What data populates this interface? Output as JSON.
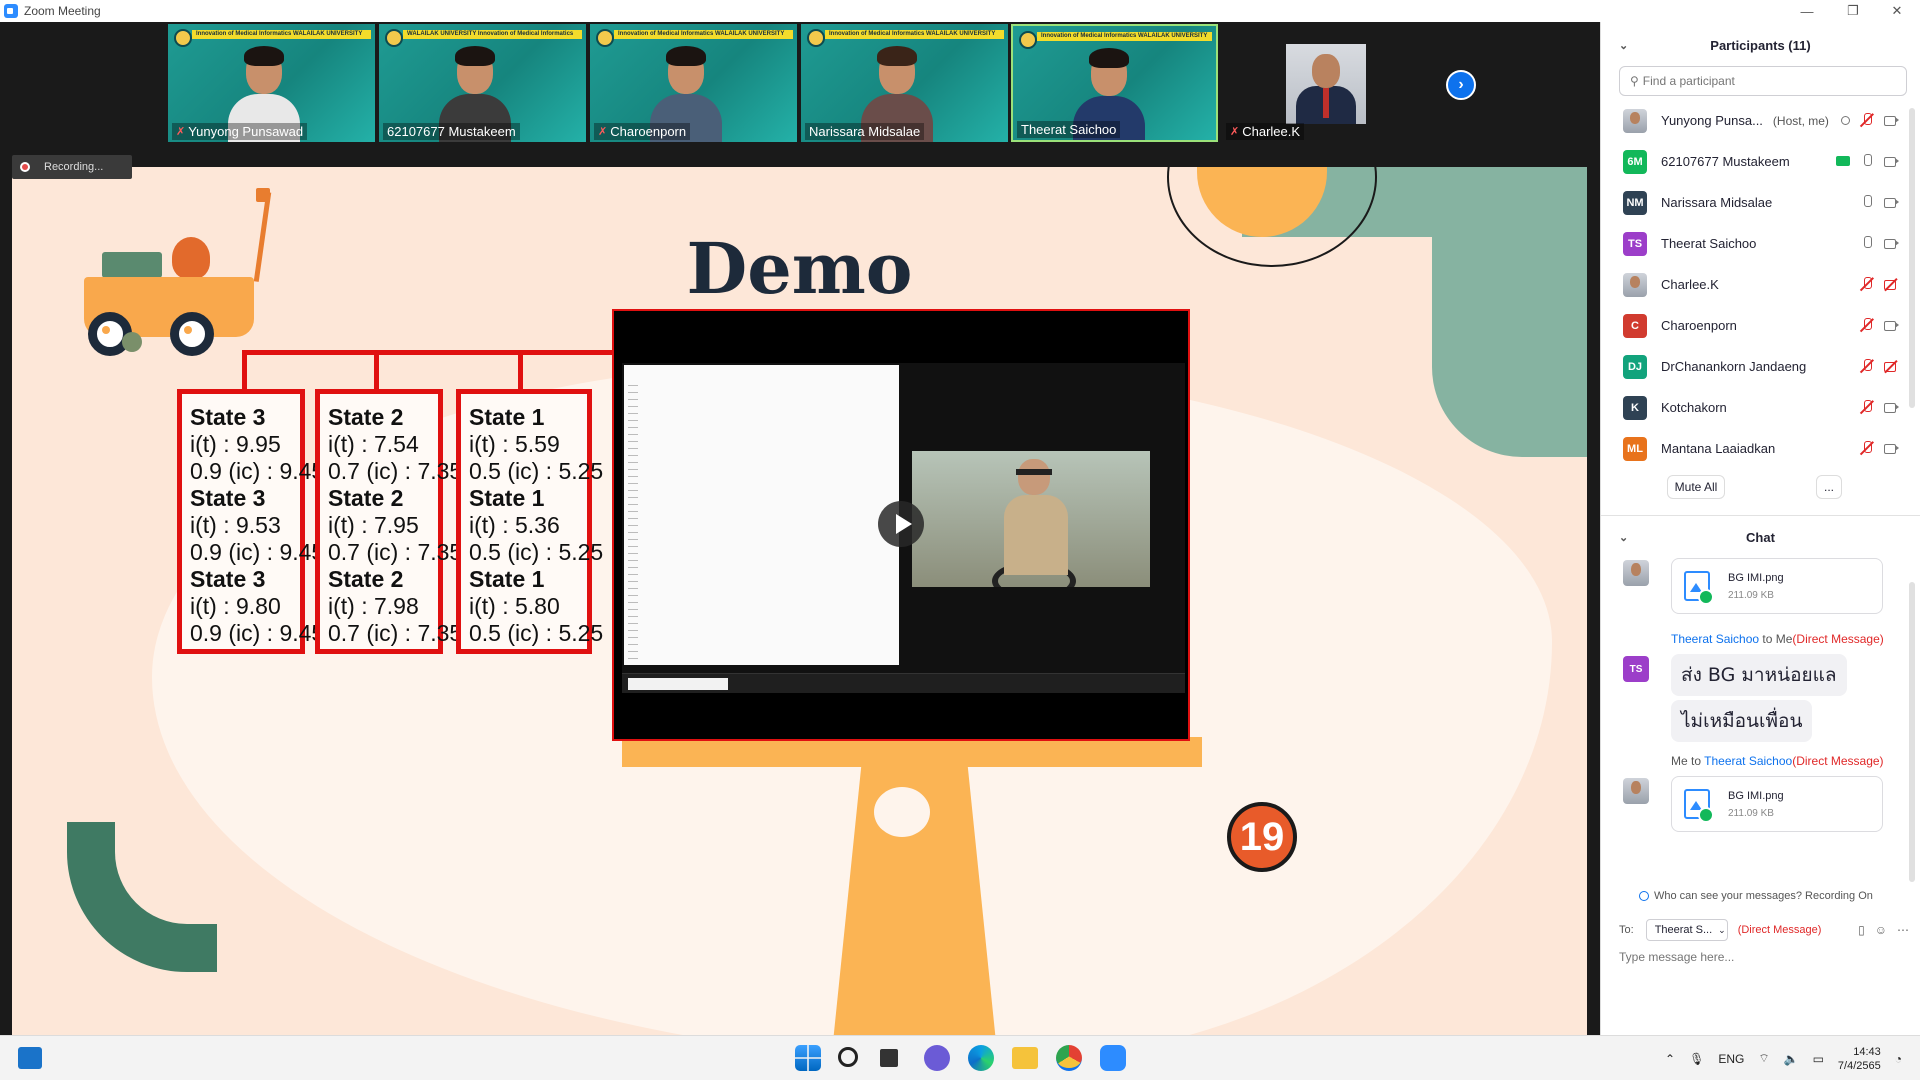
{
  "window": {
    "title": "Zoom Meeting",
    "controls": {
      "minimize": "—",
      "restore": "❐",
      "close": "✕"
    }
  },
  "video_strip": {
    "tiles": [
      {
        "name": "Yunyong Punsawad",
        "muted": true,
        "banner": "Innovation of Medical Informatics  WALAILAK UNIVERSITY"
      },
      {
        "name": "62107677 Mustakeem",
        "muted": false,
        "banner": "WALAILAK UNIVERSITY  Innovation of Medical Informatics"
      },
      {
        "name": "Charoenporn",
        "muted": true,
        "banner": "Innovation of Medical Informatics  WALAILAK UNIVERSITY"
      },
      {
        "name": "Narissara Midsalae",
        "muted": false,
        "banner": "Innovation of Medical Informatics  WALAILAK UNIVERSITY"
      },
      {
        "name": "Theerat Saichoo",
        "muted": false,
        "banner": "Innovation of Medical Informatics  WALAILAK UNIVERSITY"
      },
      {
        "name": "Charlee.K",
        "muted": true,
        "banner": ""
      }
    ],
    "next_icon": "chevron-right-icon"
  },
  "recording": {
    "label": "Recording..."
  },
  "slide": {
    "title": "Demo",
    "page_number": "19",
    "state_boxes": [
      {
        "lines": [
          {
            "text": "State 3",
            "bold": true
          },
          {
            "text": "i(t) : 9.95",
            "bold": false
          },
          {
            "text": "0.9 (ic) : 9.45",
            "bold": false
          },
          {
            "text": "State 3",
            "bold": true
          },
          {
            "text": "i(t) : 9.53",
            "bold": false
          },
          {
            "text": "0.9 (ic) : 9.45",
            "bold": false
          },
          {
            "text": "State 3",
            "bold": true
          },
          {
            "text": "i(t) : 9.80",
            "bold": false
          },
          {
            "text": "0.9 (ic) : 9.45",
            "bold": false
          }
        ]
      },
      {
        "lines": [
          {
            "text": "State 2",
            "bold": true
          },
          {
            "text": "i(t) : 7.54",
            "bold": false
          },
          {
            "text": "0.7 (ic) : 7.35",
            "bold": false
          },
          {
            "text": "State 2",
            "bold": true
          },
          {
            "text": "i(t) : 7.95",
            "bold": false
          },
          {
            "text": "0.7 (ic) : 7.35",
            "bold": false
          },
          {
            "text": "State 2",
            "bold": true
          },
          {
            "text": "i(t) : 7.98",
            "bold": false
          },
          {
            "text": "0.7 (ic) : 7.35",
            "bold": false
          }
        ]
      },
      {
        "lines": [
          {
            "text": "State 1",
            "bold": true
          },
          {
            "text": "i(t) : 5.59",
            "bold": false
          },
          {
            "text": "0.5 (ic) : 5.25",
            "bold": false
          },
          {
            "text": "State 1",
            "bold": true
          },
          {
            "text": "i(t) : 5.36",
            "bold": false
          },
          {
            "text": "0.5 (ic) : 5.25",
            "bold": false
          },
          {
            "text": "State 1",
            "bold": true
          },
          {
            "text": "i(t) : 5.80",
            "bold": false
          },
          {
            "text": "0.5 (ic) : 5.25",
            "bold": false
          }
        ]
      }
    ],
    "video_play_icon": "play-icon",
    "colors": {
      "background": "#fde7d8",
      "accent_red": "#e01010",
      "orange": "#fbb454",
      "green": "#86b3a1"
    }
  },
  "participants": {
    "title": "Participants (11)",
    "search_placeholder": "Find a participant",
    "list": [
      {
        "name": "Yunyong Punsa...",
        "role": "(Host, me)",
        "avatar_type": "photo",
        "initials": "",
        "color": "",
        "mic": "muted",
        "cam": "on"
      },
      {
        "name": "62107677 Mustakeem",
        "role": "",
        "avatar_type": "initials",
        "initials": "6M",
        "color": "#12b85a",
        "mic": "on",
        "cam": "on",
        "sharing": true
      },
      {
        "name": "Narissara Midsalae",
        "role": "",
        "avatar_type": "initials",
        "initials": "NM",
        "color": "#2f4254",
        "mic": "on",
        "cam": "on"
      },
      {
        "name": "Theerat Saichoo",
        "role": "",
        "avatar_type": "initials",
        "initials": "TS",
        "color": "#9c3ec9",
        "mic": "on",
        "cam": "on"
      },
      {
        "name": "Charlee.K",
        "role": "",
        "avatar_type": "photo",
        "initials": "",
        "color": "",
        "mic": "muted",
        "cam": "off"
      },
      {
        "name": "Charoenporn",
        "role": "",
        "avatar_type": "initials",
        "initials": "C",
        "color": "#d13b2f",
        "mic": "muted",
        "cam": "on"
      },
      {
        "name": "DrChanankorn Jandaeng",
        "role": "",
        "avatar_type": "initials",
        "initials": "DJ",
        "color": "#12a37c",
        "mic": "muted",
        "cam": "off"
      },
      {
        "name": "Kotchakorn",
        "role": "",
        "avatar_type": "initials",
        "initials": "K",
        "color": "#2f4254",
        "mic": "muted",
        "cam": "on"
      },
      {
        "name": "Mantana Laaiadkan",
        "role": "",
        "avatar_type": "initials",
        "initials": "ML",
        "color": "#e8731c",
        "mic": "muted",
        "cam": "on"
      }
    ],
    "mute_all_label": "Mute All",
    "more_label": "..."
  },
  "chat": {
    "title": "Chat",
    "messages": [
      {
        "type": "file",
        "file_name": "BG IMI.png",
        "file_size": "211.09 KB"
      },
      {
        "type": "header",
        "from": "Theerat Saichoo",
        "to": "to Me",
        "tag": "(Direct Message)"
      },
      {
        "type": "text",
        "text": "ส่ง BG มาหน่อยแล"
      },
      {
        "type": "text",
        "text": "ไม่เหมือนเพื่อน"
      },
      {
        "type": "header",
        "from": "Me to",
        "to": "Theerat Saichoo",
        "tag": "(Direct Message)"
      },
      {
        "type": "file",
        "file_name": "BG IMI.png",
        "file_size": "211.09 KB"
      }
    ],
    "visibility_note": "Who can see your messages? Recording On",
    "to_label": "To:",
    "recipient": "Theerat S...",
    "direct_label": "(Direct Message)",
    "input_placeholder": "Type message here..."
  },
  "taskbar": {
    "language": "ENG",
    "time": "14:43",
    "date": "7/4/2565"
  }
}
